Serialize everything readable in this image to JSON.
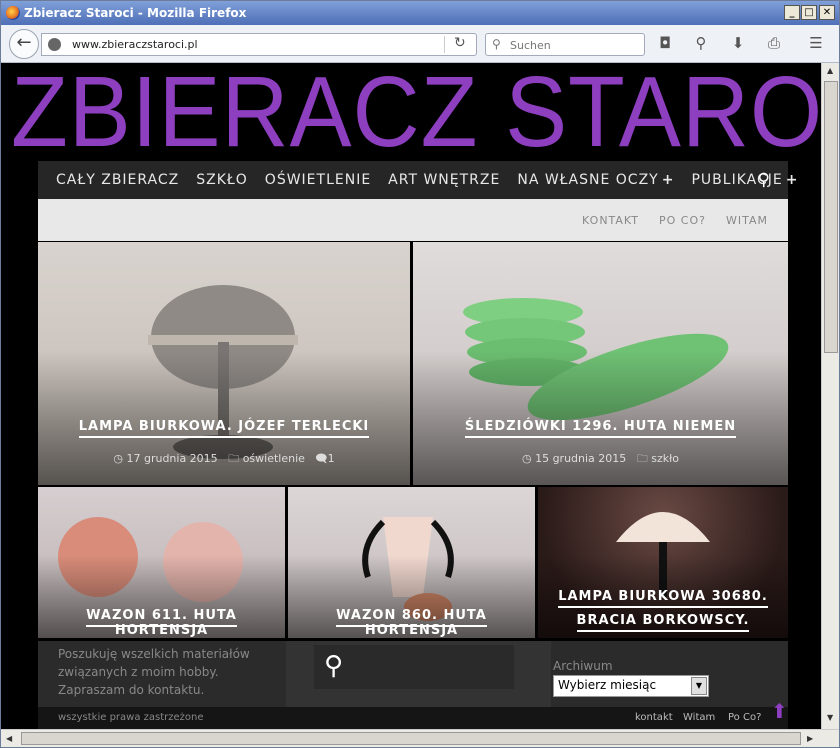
{
  "window": {
    "title": "Zbieracz Staroci - Mozilla Firefox",
    "minimize": "_",
    "maximize": "□",
    "close": "✕"
  },
  "browser": {
    "url": "www.zbieraczstaroci.pl",
    "search_placeholder": "Suchen"
  },
  "site": {
    "logo": "ZBIERACZ STAROCI",
    "menu": [
      {
        "label": "CAŁY ZBIERACZ"
      },
      {
        "label": "SZKŁO"
      },
      {
        "label": "OŚWIETLENIE"
      },
      {
        "label": "ART WNĘTRZE"
      },
      {
        "label": "NA WŁASNE OCZY",
        "plus": "+"
      },
      {
        "label": "PUBLIKACJE",
        "plus": "+"
      }
    ],
    "sublinks": [
      "KONTAKT",
      "PO CO?",
      "WITAM"
    ],
    "posts": [
      {
        "title": "LAMPA BIURKOWA. JÓZEF TERLECKI",
        "date": "17 grudnia 2015",
        "category": "oświetlenie",
        "comments": "1"
      },
      {
        "title": "ŚLEDZIÓWKI 1296. HUTA NIEMEN",
        "date": "15 grudnia 2015",
        "category": "szkło"
      },
      {
        "title": "WAZON 611. HUTA HORTENSJA"
      },
      {
        "title": "WAZON 860. HUTA HORTENSJA"
      },
      {
        "title_line1": "LAMPA BIURKOWA 30680.",
        "title_line2": "BRACIA BORKOWSCY."
      }
    ],
    "footer": {
      "about": "Poszukuję wszelkich materiałów związanych z moim hobby. Zapraszam do kontaktu.",
      "archive_label": "Archiwum",
      "archive_select": "Wybierz miesiąc",
      "copyright": "wszystkie prawa zastrzeżone",
      "links": [
        "kontakt",
        "Witam",
        "Po Co?"
      ]
    }
  },
  "colors": {
    "logo": "#8d3fc0",
    "menu_bg": "#262626",
    "page_bg": "#000000"
  }
}
